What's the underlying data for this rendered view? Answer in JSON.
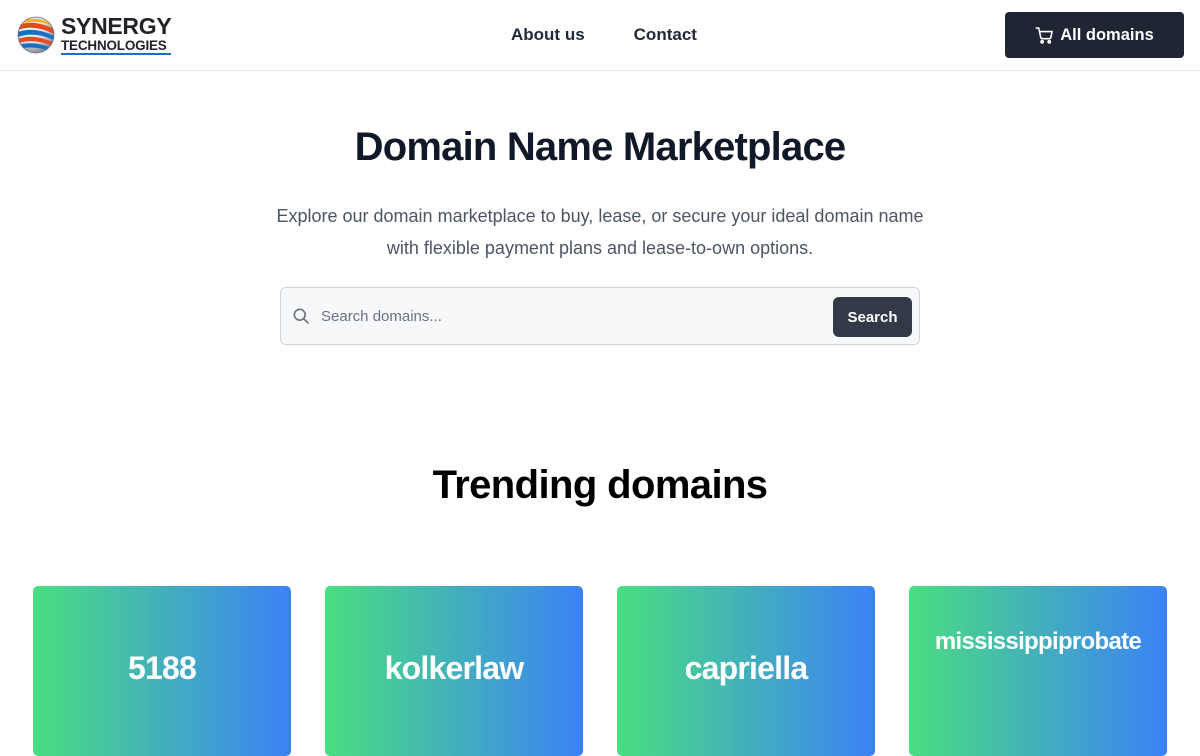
{
  "header": {
    "logo": {
      "word1": "SYNERGY",
      "word2": "TECHNOLOGIES"
    },
    "nav": [
      {
        "label": "About us"
      },
      {
        "label": "Contact"
      }
    ],
    "cart_button": {
      "label": "All domains",
      "icon": "cart-icon"
    }
  },
  "hero": {
    "title": "Domain Name Marketplace",
    "description": "Explore our domain marketplace to buy, lease, or secure your ideal domain name with flexible payment plans and lease-to-own options.",
    "search": {
      "placeholder": "Search domains...",
      "value": "",
      "button_label": "Search",
      "icon": "search-icon"
    }
  },
  "trending": {
    "title": "Trending domains",
    "cards": [
      {
        "name": "5188"
      },
      {
        "name": "kolkerlaw"
      },
      {
        "name": "capriella"
      },
      {
        "name": "mississippiprobate"
      }
    ]
  },
  "colors": {
    "primary_dark": "#1f2533",
    "search_button": "#333a47",
    "card_gradient_start": "#4ade80",
    "card_gradient_end": "#3b82f6",
    "logo_underline": "#1b6fc2"
  }
}
